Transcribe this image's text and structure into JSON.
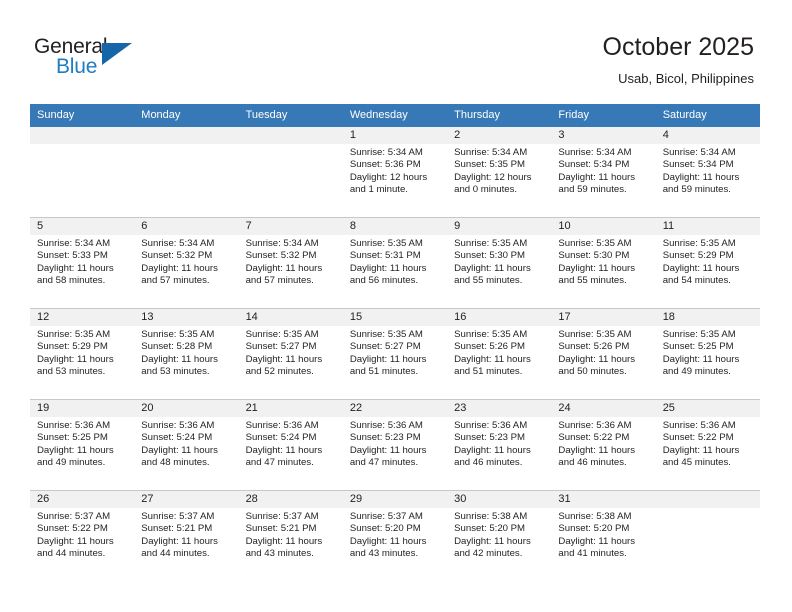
{
  "brand": {
    "name_part1": "General",
    "name_part2": "Blue",
    "triangle_color": "#1565a8",
    "blue_color": "#1f7dc4"
  },
  "header": {
    "month_title": "October 2025",
    "location": "Usab, Bicol, Philippines"
  },
  "theme": {
    "header_row_bg": "#3778b6",
    "daynum_band_bg": "#f1f1f1",
    "grid_line": "#c8c8c8",
    "text": "#231f20"
  },
  "weekday_headers": [
    "Sunday",
    "Monday",
    "Tuesday",
    "Wednesday",
    "Thursday",
    "Friday",
    "Saturday"
  ],
  "weeks": [
    [
      {
        "day": "",
        "blank": true,
        "sunrise": "",
        "sunset": "",
        "daylight_line1": "",
        "daylight_line2": ""
      },
      {
        "day": "",
        "blank": true,
        "sunrise": "",
        "sunset": "",
        "daylight_line1": "",
        "daylight_line2": ""
      },
      {
        "day": "",
        "blank": true,
        "sunrise": "",
        "sunset": "",
        "daylight_line1": "",
        "daylight_line2": ""
      },
      {
        "day": "1",
        "blank": false,
        "sunrise": "Sunrise: 5:34 AM",
        "sunset": "Sunset: 5:36 PM",
        "daylight_line1": "Daylight: 12 hours",
        "daylight_line2": "and 1 minute."
      },
      {
        "day": "2",
        "blank": false,
        "sunrise": "Sunrise: 5:34 AM",
        "sunset": "Sunset: 5:35 PM",
        "daylight_line1": "Daylight: 12 hours",
        "daylight_line2": "and 0 minutes."
      },
      {
        "day": "3",
        "blank": false,
        "sunrise": "Sunrise: 5:34 AM",
        "sunset": "Sunset: 5:34 PM",
        "daylight_line1": "Daylight: 11 hours",
        "daylight_line2": "and 59 minutes."
      },
      {
        "day": "4",
        "blank": false,
        "sunrise": "Sunrise: 5:34 AM",
        "sunset": "Sunset: 5:34 PM",
        "daylight_line1": "Daylight: 11 hours",
        "daylight_line2": "and 59 minutes."
      }
    ],
    [
      {
        "day": "5",
        "blank": false,
        "sunrise": "Sunrise: 5:34 AM",
        "sunset": "Sunset: 5:33 PM",
        "daylight_line1": "Daylight: 11 hours",
        "daylight_line2": "and 58 minutes."
      },
      {
        "day": "6",
        "blank": false,
        "sunrise": "Sunrise: 5:34 AM",
        "sunset": "Sunset: 5:32 PM",
        "daylight_line1": "Daylight: 11 hours",
        "daylight_line2": "and 57 minutes."
      },
      {
        "day": "7",
        "blank": false,
        "sunrise": "Sunrise: 5:34 AM",
        "sunset": "Sunset: 5:32 PM",
        "daylight_line1": "Daylight: 11 hours",
        "daylight_line2": "and 57 minutes."
      },
      {
        "day": "8",
        "blank": false,
        "sunrise": "Sunrise: 5:35 AM",
        "sunset": "Sunset: 5:31 PM",
        "daylight_line1": "Daylight: 11 hours",
        "daylight_line2": "and 56 minutes."
      },
      {
        "day": "9",
        "blank": false,
        "sunrise": "Sunrise: 5:35 AM",
        "sunset": "Sunset: 5:30 PM",
        "daylight_line1": "Daylight: 11 hours",
        "daylight_line2": "and 55 minutes."
      },
      {
        "day": "10",
        "blank": false,
        "sunrise": "Sunrise: 5:35 AM",
        "sunset": "Sunset: 5:30 PM",
        "daylight_line1": "Daylight: 11 hours",
        "daylight_line2": "and 55 minutes."
      },
      {
        "day": "11",
        "blank": false,
        "sunrise": "Sunrise: 5:35 AM",
        "sunset": "Sunset: 5:29 PM",
        "daylight_line1": "Daylight: 11 hours",
        "daylight_line2": "and 54 minutes."
      }
    ],
    [
      {
        "day": "12",
        "blank": false,
        "sunrise": "Sunrise: 5:35 AM",
        "sunset": "Sunset: 5:29 PM",
        "daylight_line1": "Daylight: 11 hours",
        "daylight_line2": "and 53 minutes."
      },
      {
        "day": "13",
        "blank": false,
        "sunrise": "Sunrise: 5:35 AM",
        "sunset": "Sunset: 5:28 PM",
        "daylight_line1": "Daylight: 11 hours",
        "daylight_line2": "and 53 minutes."
      },
      {
        "day": "14",
        "blank": false,
        "sunrise": "Sunrise: 5:35 AM",
        "sunset": "Sunset: 5:27 PM",
        "daylight_line1": "Daylight: 11 hours",
        "daylight_line2": "and 52 minutes."
      },
      {
        "day": "15",
        "blank": false,
        "sunrise": "Sunrise: 5:35 AM",
        "sunset": "Sunset: 5:27 PM",
        "daylight_line1": "Daylight: 11 hours",
        "daylight_line2": "and 51 minutes."
      },
      {
        "day": "16",
        "blank": false,
        "sunrise": "Sunrise: 5:35 AM",
        "sunset": "Sunset: 5:26 PM",
        "daylight_line1": "Daylight: 11 hours",
        "daylight_line2": "and 51 minutes."
      },
      {
        "day": "17",
        "blank": false,
        "sunrise": "Sunrise: 5:35 AM",
        "sunset": "Sunset: 5:26 PM",
        "daylight_line1": "Daylight: 11 hours",
        "daylight_line2": "and 50 minutes."
      },
      {
        "day": "18",
        "blank": false,
        "sunrise": "Sunrise: 5:35 AM",
        "sunset": "Sunset: 5:25 PM",
        "daylight_line1": "Daylight: 11 hours",
        "daylight_line2": "and 49 minutes."
      }
    ],
    [
      {
        "day": "19",
        "blank": false,
        "sunrise": "Sunrise: 5:36 AM",
        "sunset": "Sunset: 5:25 PM",
        "daylight_line1": "Daylight: 11 hours",
        "daylight_line2": "and 49 minutes."
      },
      {
        "day": "20",
        "blank": false,
        "sunrise": "Sunrise: 5:36 AM",
        "sunset": "Sunset: 5:24 PM",
        "daylight_line1": "Daylight: 11 hours",
        "daylight_line2": "and 48 minutes."
      },
      {
        "day": "21",
        "blank": false,
        "sunrise": "Sunrise: 5:36 AM",
        "sunset": "Sunset: 5:24 PM",
        "daylight_line1": "Daylight: 11 hours",
        "daylight_line2": "and 47 minutes."
      },
      {
        "day": "22",
        "blank": false,
        "sunrise": "Sunrise: 5:36 AM",
        "sunset": "Sunset: 5:23 PM",
        "daylight_line1": "Daylight: 11 hours",
        "daylight_line2": "and 47 minutes."
      },
      {
        "day": "23",
        "blank": false,
        "sunrise": "Sunrise: 5:36 AM",
        "sunset": "Sunset: 5:23 PM",
        "daylight_line1": "Daylight: 11 hours",
        "daylight_line2": "and 46 minutes."
      },
      {
        "day": "24",
        "blank": false,
        "sunrise": "Sunrise: 5:36 AM",
        "sunset": "Sunset: 5:22 PM",
        "daylight_line1": "Daylight: 11 hours",
        "daylight_line2": "and 46 minutes."
      },
      {
        "day": "25",
        "blank": false,
        "sunrise": "Sunrise: 5:36 AM",
        "sunset": "Sunset: 5:22 PM",
        "daylight_line1": "Daylight: 11 hours",
        "daylight_line2": "and 45 minutes."
      }
    ],
    [
      {
        "day": "26",
        "blank": false,
        "sunrise": "Sunrise: 5:37 AM",
        "sunset": "Sunset: 5:22 PM",
        "daylight_line1": "Daylight: 11 hours",
        "daylight_line2": "and 44 minutes."
      },
      {
        "day": "27",
        "blank": false,
        "sunrise": "Sunrise: 5:37 AM",
        "sunset": "Sunset: 5:21 PM",
        "daylight_line1": "Daylight: 11 hours",
        "daylight_line2": "and 44 minutes."
      },
      {
        "day": "28",
        "blank": false,
        "sunrise": "Sunrise: 5:37 AM",
        "sunset": "Sunset: 5:21 PM",
        "daylight_line1": "Daylight: 11 hours",
        "daylight_line2": "and 43 minutes."
      },
      {
        "day": "29",
        "blank": false,
        "sunrise": "Sunrise: 5:37 AM",
        "sunset": "Sunset: 5:20 PM",
        "daylight_line1": "Daylight: 11 hours",
        "daylight_line2": "and 43 minutes."
      },
      {
        "day": "30",
        "blank": false,
        "sunrise": "Sunrise: 5:38 AM",
        "sunset": "Sunset: 5:20 PM",
        "daylight_line1": "Daylight: 11 hours",
        "daylight_line2": "and 42 minutes."
      },
      {
        "day": "31",
        "blank": false,
        "sunrise": "Sunrise: 5:38 AM",
        "sunset": "Sunset: 5:20 PM",
        "daylight_line1": "Daylight: 11 hours",
        "daylight_line2": "and 41 minutes."
      },
      {
        "day": "",
        "blank": true,
        "sunrise": "",
        "sunset": "",
        "daylight_line1": "",
        "daylight_line2": ""
      }
    ]
  ]
}
